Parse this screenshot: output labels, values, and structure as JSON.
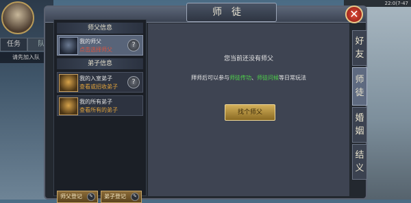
{
  "hud": {
    "task_tab": "任务",
    "team_tab": "队",
    "hint": "请先加入队",
    "clock": "22:0(7-47"
  },
  "panel": {
    "title": "师徒"
  },
  "left": {
    "master_header": "师父信息",
    "disciple_header": "弟子信息",
    "my_master": {
      "title": "我的师父",
      "subtitle": "点击选择师父"
    },
    "enrolled": {
      "title": "我的入室弟子",
      "subtitle": "查看或招收弟子"
    },
    "all": {
      "title": "我的所有弟子",
      "subtitle": "查看所有的弟子"
    },
    "q_label": "?"
  },
  "bottom": {
    "master_reg": "师父登记",
    "disciple_reg": "弟子登记",
    "pen": "✎"
  },
  "content": {
    "line1": "您当前还没有师父",
    "line2_pre": "拜师后可以参与",
    "line2_hl1": "师徒传功",
    "line2_sep": "、",
    "line2_hl2": "师徒问候",
    "line2_post": "等日常玩法",
    "find_btn": "找个师父"
  },
  "side_tabs": [
    {
      "c1": "好",
      "c2": "友"
    },
    {
      "c1": "师",
      "c2": "徒"
    },
    {
      "c1": "婚",
      "c2": "姻"
    },
    {
      "c1": "结",
      "c2": "义"
    }
  ],
  "close_label": "✕"
}
